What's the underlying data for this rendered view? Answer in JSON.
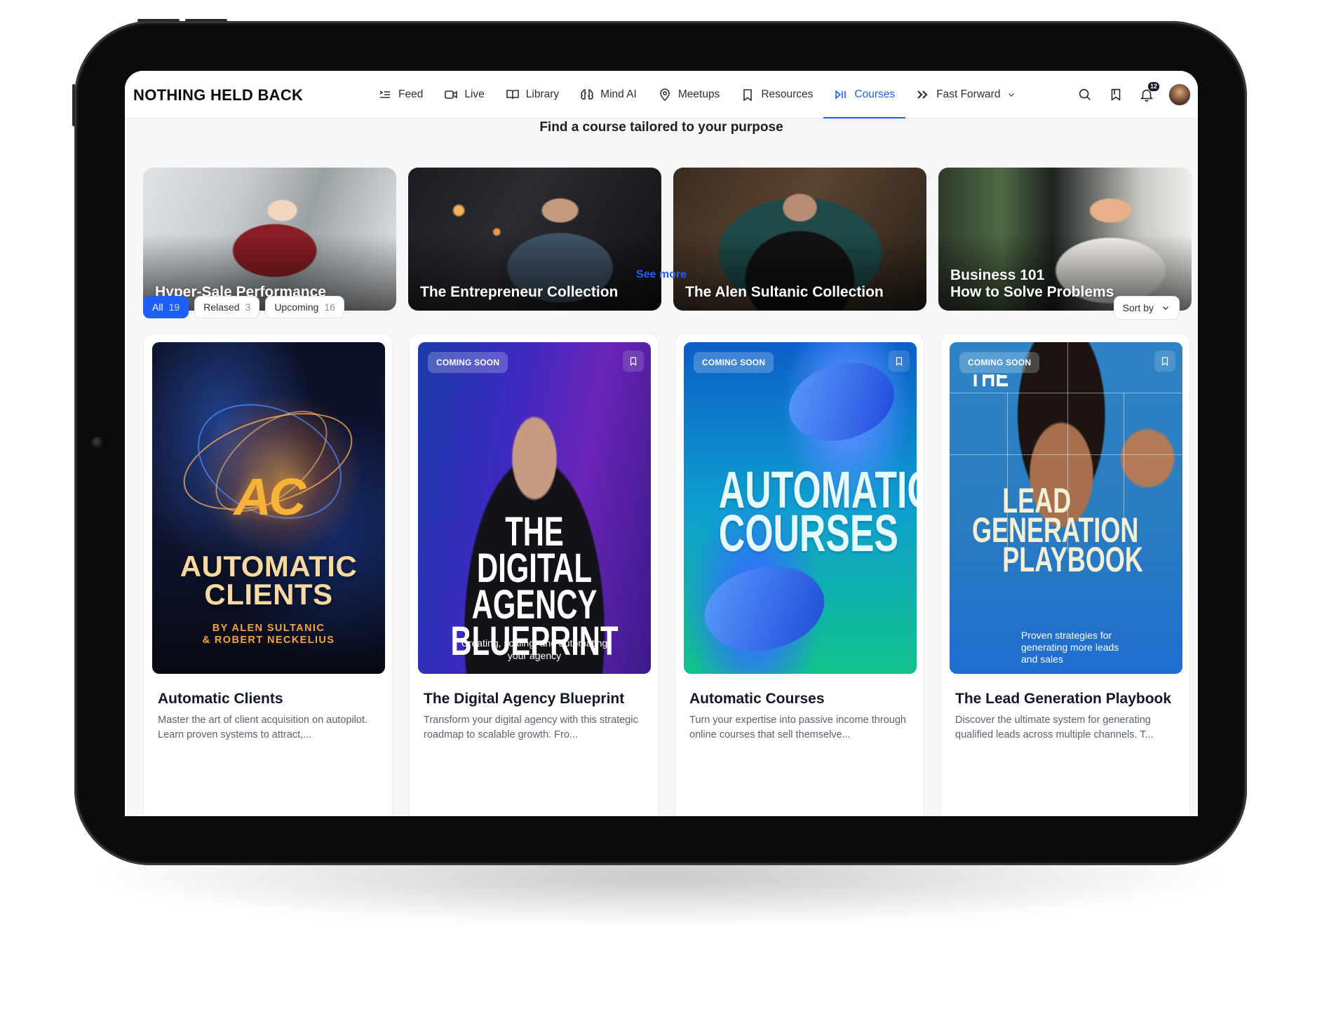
{
  "header": {
    "logo": "NOTHING HELD BACK",
    "nav": [
      {
        "label": "Feed",
        "icon": "feed-icon"
      },
      {
        "label": "Live",
        "icon": "video-icon"
      },
      {
        "label": "Library",
        "icon": "book-icon"
      },
      {
        "label": "Mind AI",
        "icon": "brain-icon"
      },
      {
        "label": "Meetups",
        "icon": "location-pin-icon"
      },
      {
        "label": "Resources",
        "icon": "bookmark-icon"
      },
      {
        "label": "Courses",
        "icon": "play-pause-icon",
        "active": true
      },
      {
        "label": "Fast Forward",
        "icon": "fast-forward-icon",
        "has_dropdown": true
      }
    ],
    "notification_count": "12"
  },
  "hero": {
    "title": "Find a course tailored to your purpose",
    "collections": [
      {
        "title": "Hyper-Sale Performance"
      },
      {
        "title": "The Entrepreneur Collection"
      },
      {
        "title": "The Alen Sultanic Collection"
      },
      {
        "title_line1": "Business 101",
        "title_line2": "How to Solve Problems"
      }
    ],
    "see_more": "See more"
  },
  "filters": {
    "chips": [
      {
        "label": "All",
        "count": "19",
        "active": true
      },
      {
        "label": "Relased",
        "count": "3"
      },
      {
        "label": "Upcoming",
        "count": "16"
      }
    ],
    "sort_label": "Sort by"
  },
  "courses": [
    {
      "title": "Automatic Clients",
      "description": "Master the art of client acquisition on autopilot. Learn proven systems to attract,...",
      "cover": {
        "logo": "AC",
        "title": "AUTOMATIC CLIENTS",
        "byline1": "BY ALEN SULTANIC",
        "byline2": "& ROBERT NECKELIUS"
      }
    },
    {
      "title": "The Digital Agency Blueprint",
      "description": "Transform your digital agency with this strategic roadmap to scalable growth. Fro...",
      "badge": "COMING SOON",
      "cover": {
        "title_l1": "THE DIGITAL",
        "title_l2": "AGENCY",
        "title_l3": "BLUEPRINT",
        "subtitle": "Creating, scaling, and automating your agency"
      }
    },
    {
      "title": "Automatic Courses",
      "description": "Turn your expertise into passive income through online courses that sell themselve...",
      "badge": "COMING SOON",
      "cover": {
        "title_l1": "AUTOMATIC",
        "title_l2": "COURSES"
      }
    },
    {
      "title": "The Lead Generation Playbook",
      "description": "Discover the ultimate system for generating qualified leads across multiple channels. T...",
      "badge": "COMING SOON",
      "cover": {
        "top": "THE",
        "title_l1": "LEAD",
        "title_l2": "GENERATION",
        "title_l3": "PLAYBOOK",
        "subtitle": "Proven strategies for generating more leads and sales"
      }
    }
  ],
  "colors": {
    "accent": "#1f5ef7",
    "text": "#111827",
    "muted": "#5b6270"
  }
}
